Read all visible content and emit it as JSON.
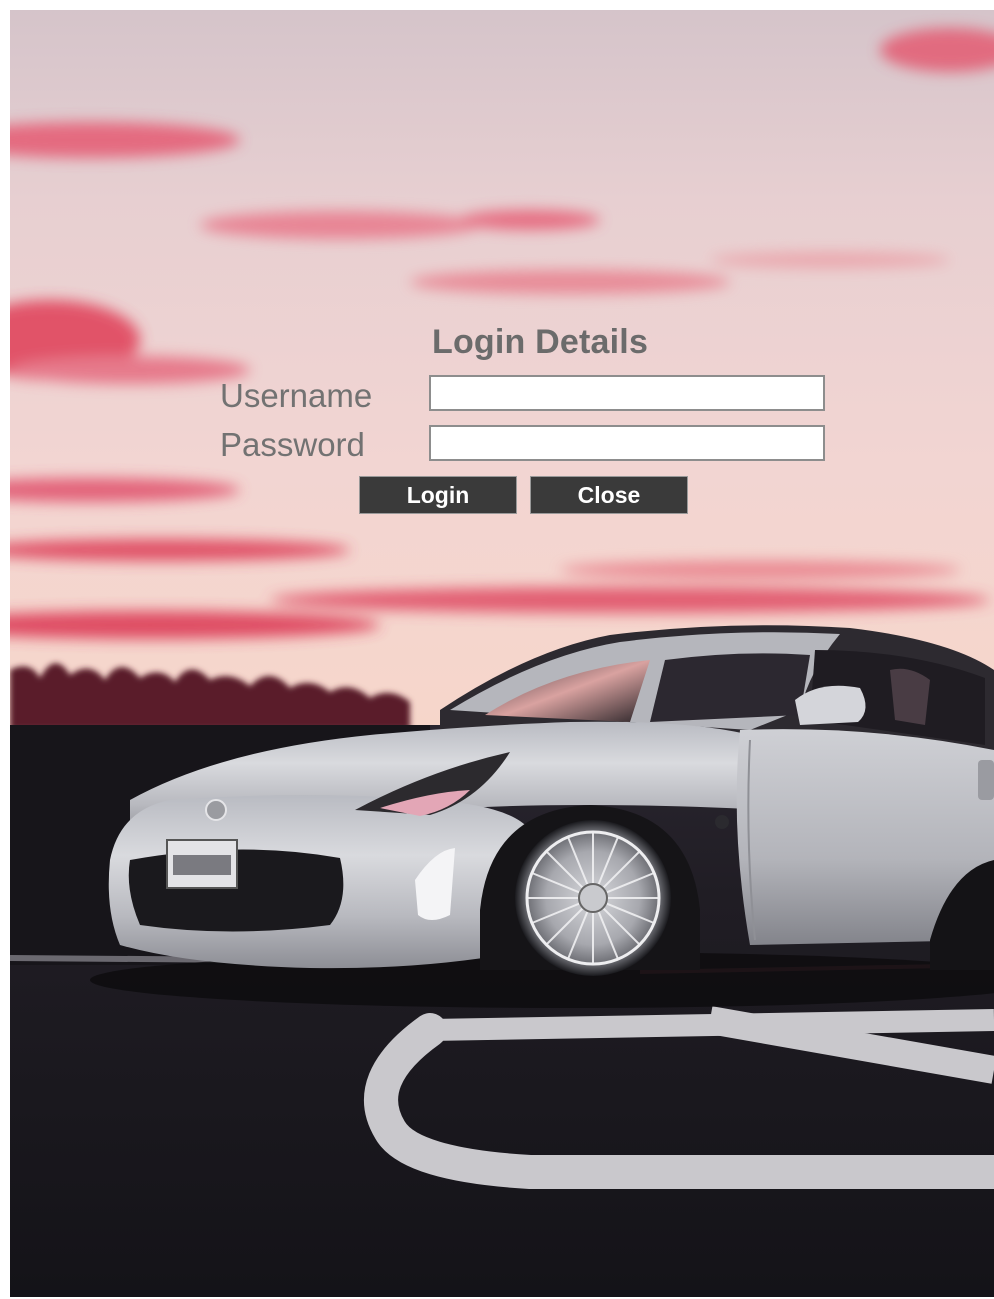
{
  "login": {
    "title": "Login Details",
    "username_label": "Username",
    "password_label": "Password",
    "username_value": "",
    "password_value": "",
    "login_button": "Login",
    "close_button": "Close"
  },
  "colors": {
    "sky_top": "#d9c4c8",
    "sky_mid": "#efd3d2",
    "sky_horizon": "#f6d3c6",
    "cloud_accent": "#e04660",
    "car_body": "#c8c9cd",
    "asphalt": "#1e1c22",
    "button_bg": "#3a3a3a",
    "label_gray": "#727272"
  }
}
